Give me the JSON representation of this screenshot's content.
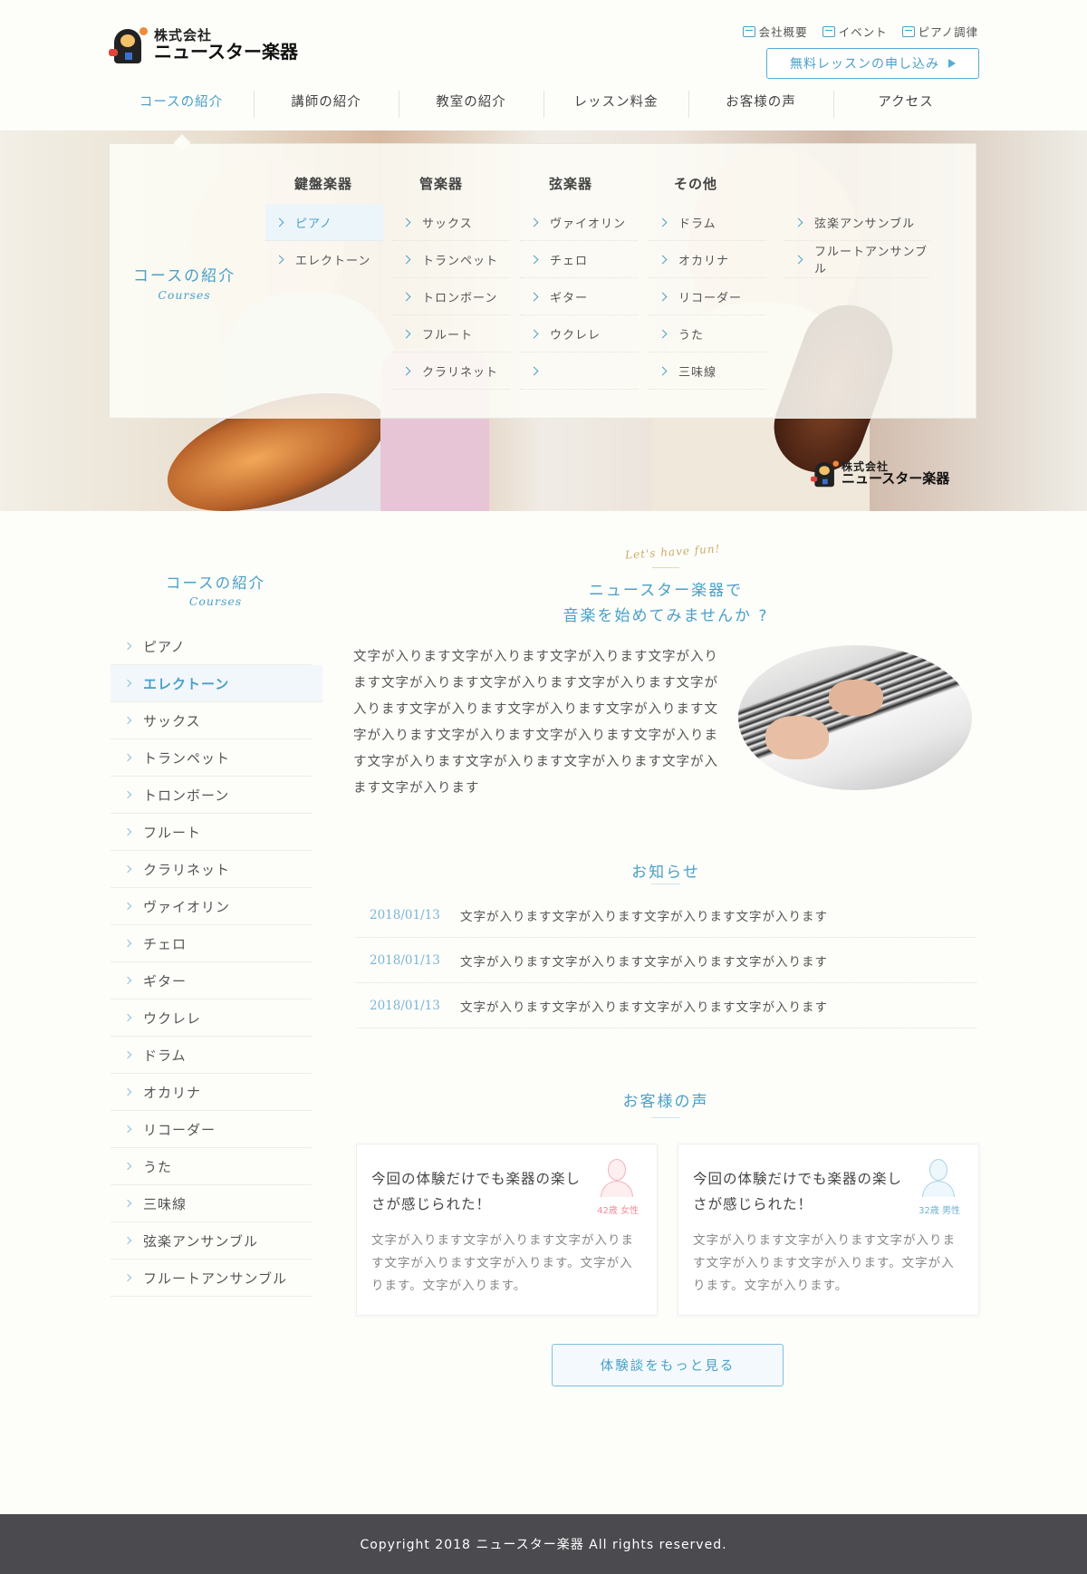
{
  "header": {
    "logo_company_prefix": "株式会社",
    "logo_company_name": "ニュースター楽器",
    "util_links": [
      "会社概要",
      "イベント",
      "ピアノ調律"
    ],
    "util_icons": [
      "building-icon",
      "calendar-icon",
      "piano-icon"
    ],
    "cta_label": "無料レッスンの申し込み"
  },
  "gnav": {
    "items": [
      "コースの紹介",
      "講師の紹介",
      "教室の紹介",
      "レッスン料金",
      "お客様の声",
      "アクセス"
    ],
    "active_index": 0
  },
  "mega_menu": {
    "title": "コースの紹介",
    "title_en": "Courses",
    "categories": [
      "鍵盤楽器",
      "管楽器",
      "弦楽器",
      "その他"
    ],
    "columns": [
      [
        "ピアノ",
        "エレクトーン"
      ],
      [
        "サックス",
        "トランペット",
        "トロンボーン",
        "フルート",
        "クラリネット"
      ],
      [
        "ヴァイオリン",
        "チェロ",
        "ギター",
        "ウクレレ",
        ""
      ],
      [
        "ドラム",
        "オカリナ",
        "リコーダー",
        "うた",
        "三味線"
      ],
      [
        "弦楽アンサンブル",
        "フルートアンサンブル"
      ]
    ],
    "active_item": "ピアノ"
  },
  "hero": {
    "logo_prefix": "株式会社",
    "logo_name": "ニュースター楽器"
  },
  "sidebar": {
    "title": "コースの紹介",
    "title_en": "Courses",
    "items": [
      "ピアノ",
      "エレクトーン",
      "サックス",
      "トランペット",
      "トロンボーン",
      "フルート",
      "クラリネット",
      "ヴァイオリン",
      "チェロ",
      "ギター",
      "ウクレレ",
      "ドラム",
      "オカリナ",
      "リコーダー",
      "うた",
      "三味線",
      "弦楽アンサンブル",
      "フルートアンサンブル"
    ],
    "active_item": "エレクトーン"
  },
  "intro": {
    "tagline": "Let's have fun!",
    "title_line1": "ニュースター楽器で",
    "title_line2": "音楽を始めてみませんか ?",
    "body": "文字が入ります文字が入ります文字が入ります文字が入ります文字が入ります文字が入ります文字が入ります文字が入ります文字が入ります文字が入ります文字が入ります文字が入ります文字が入ります文字が入ります文字が入ります文字が入ります文字が入ります文字が入ります文字が入ます文字が入ります"
  },
  "news": {
    "title": "お知らせ",
    "items": [
      {
        "date": "2018/01/13",
        "text": "文字が入ります文字が入ります文字が入ります文字が入ります"
      },
      {
        "date": "2018/01/13",
        "text": "文字が入ります文字が入ります文字が入ります文字が入ります"
      },
      {
        "date": "2018/01/13",
        "text": "文字が入ります文字が入ります文字が入ります文字が入ります"
      }
    ]
  },
  "voices": {
    "title": "お客様の声",
    "items": [
      {
        "headline": "今回の体験だけでも楽器の楽しさが感じられた！",
        "body": "文字が入ります文字が入ります文字が入ります文字が入ります文字が入ります。文字が入ります。文字が入ります。",
        "age": "42歳 女性",
        "avatar": "female-avatar-icon"
      },
      {
        "headline": "今回の体験だけでも楽器の楽しさが感じられた！",
        "body": "文字が入ります文字が入ります文字が入ります文字が入ります文字が入ります。文字が入ります。文字が入ります。",
        "age": "32歳 男性",
        "avatar": "male-avatar-icon"
      }
    ],
    "more_label": "体験談をもっと見る"
  },
  "footer": {
    "copyright": "Copyright 2018 ニュースター楽器 All rights reserved."
  },
  "colors": {
    "accent": "#4aa0c8",
    "accent_light": "#ecf5fa",
    "footer_bg": "#4a4a4f",
    "page_bg": "#fdfdfa",
    "female": "#f08e9b",
    "male": "#6eb4d6"
  }
}
